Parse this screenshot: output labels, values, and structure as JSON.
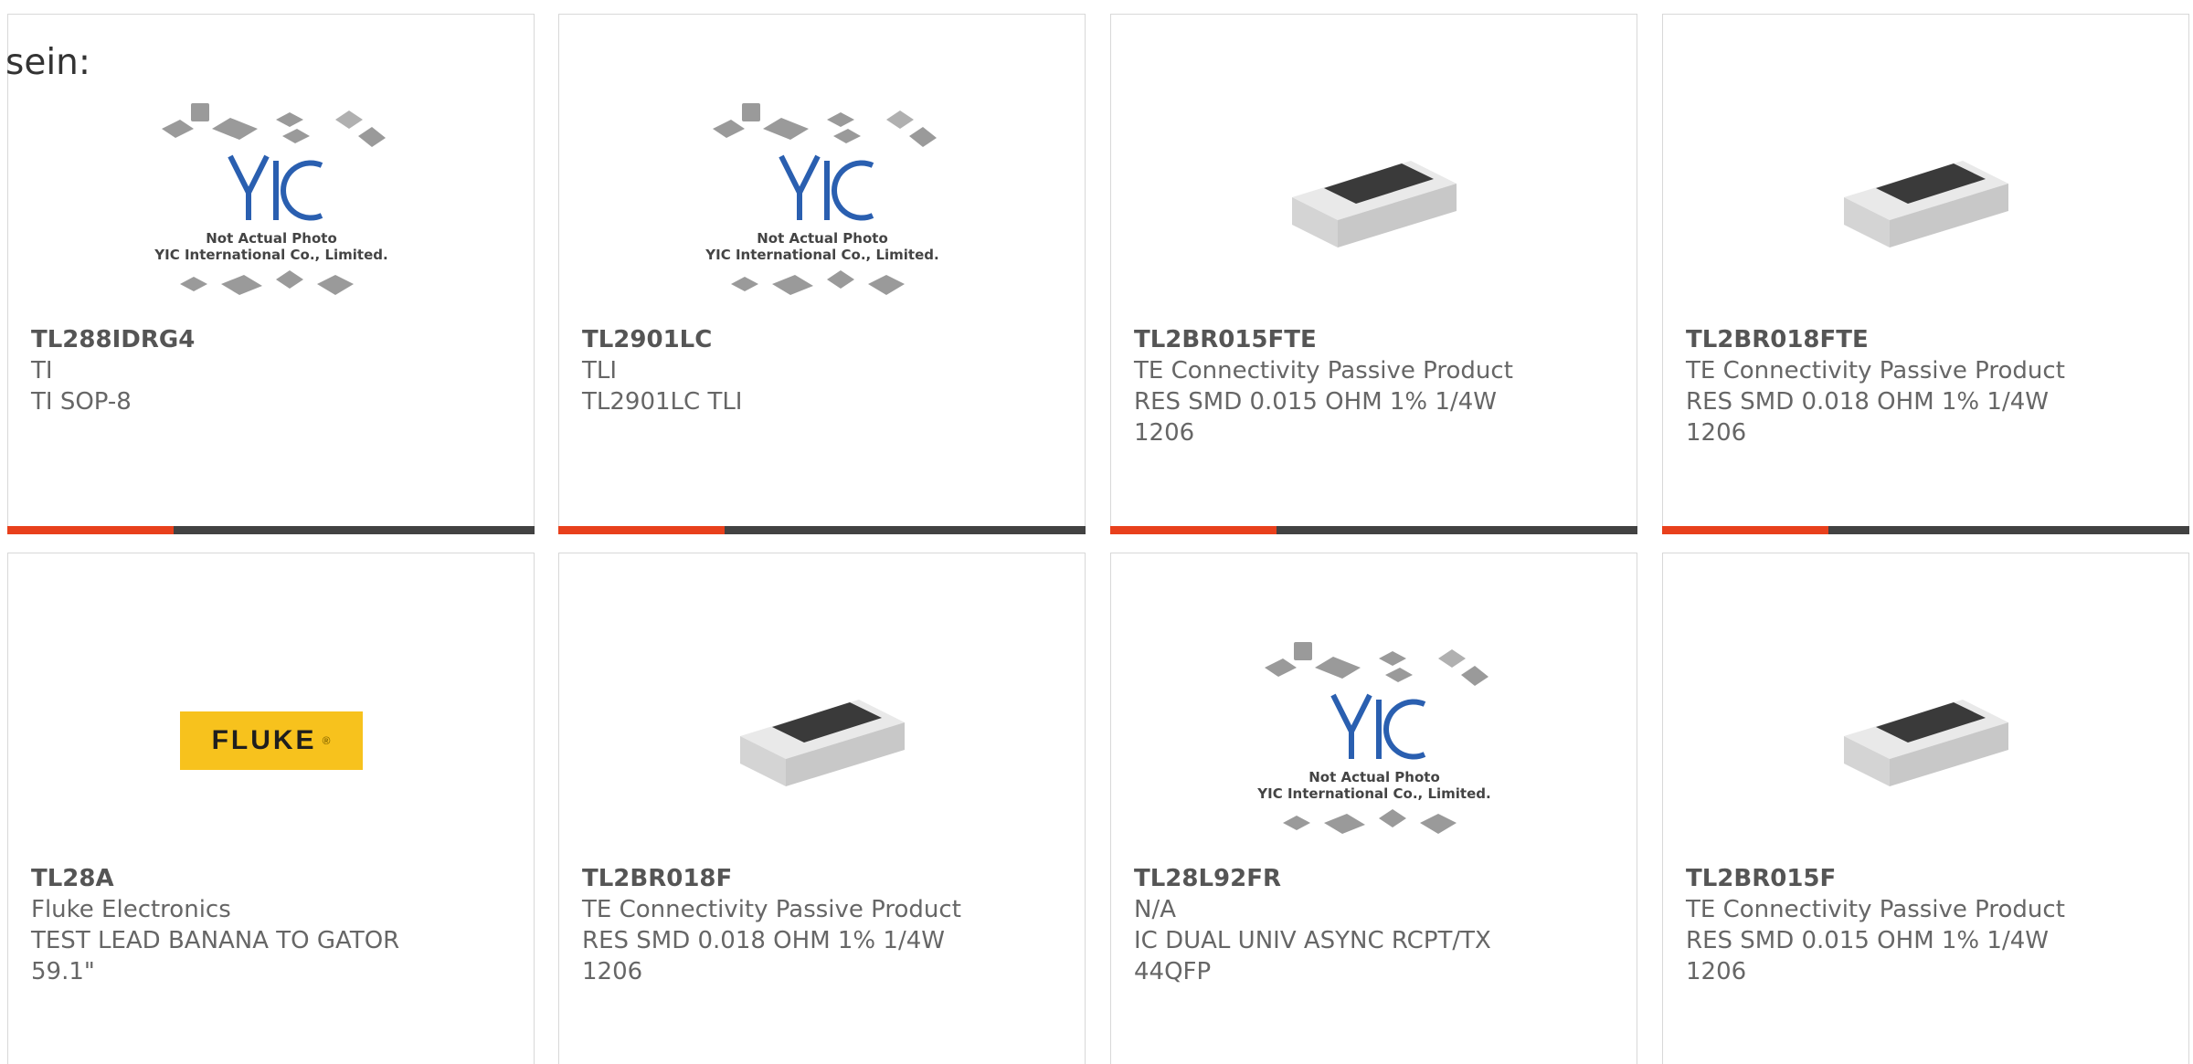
{
  "fragment_text": "sein:",
  "colors": {
    "accent_red": "#e8401c",
    "accent_dark": "#424242",
    "card_border": "#d8d8d8"
  },
  "cards": [
    {
      "pn": "TL288IDRG4",
      "mfr": "TI",
      "desc": "TI SOP-8",
      "image": "yic-placeholder",
      "placeholder_lines": [
        "Not Actual Photo",
        "YIC International Co., Limited."
      ]
    },
    {
      "pn": "TL2901LC",
      "mfr": "TLI",
      "desc": "TL2901LC TLI",
      "image": "yic-placeholder",
      "placeholder_lines": [
        "Not Actual Photo",
        "YIC International Co., Limited."
      ]
    },
    {
      "pn": "TL2BR015FTE",
      "mfr": "TE Connectivity Passive Product",
      "desc": "RES SMD 0.015 OHM 1% 1/4W 1206",
      "image": "smd-resistor"
    },
    {
      "pn": "TL2BR018FTE",
      "mfr": "TE Connectivity Passive Product",
      "desc": "RES SMD 0.018 OHM 1% 1/4W 1206",
      "image": "smd-resistor"
    },
    {
      "pn": "TL28A",
      "mfr": "Fluke Electronics",
      "desc": "TEST LEAD BANANA TO GATOR 59.1\"",
      "image": "fluke-logo",
      "logo_text": "FLUKE"
    },
    {
      "pn": "TL2BR018F",
      "mfr": "TE Connectivity Passive Product",
      "desc": "RES SMD 0.018 OHM 1% 1/4W 1206",
      "image": "smd-resistor"
    },
    {
      "pn": "TL28L92FR",
      "mfr": "N/A",
      "desc": "IC DUAL UNIV ASYNC RCPT/TX 44QFP",
      "image": "yic-placeholder",
      "placeholder_lines": [
        "Not Actual Photo",
        "YIC International Co., Limited."
      ]
    },
    {
      "pn": "TL2BR015F",
      "mfr": "TE Connectivity Passive Product",
      "desc": "RES SMD 0.015 OHM 1% 1/4W 1206",
      "image": "smd-resistor"
    }
  ]
}
